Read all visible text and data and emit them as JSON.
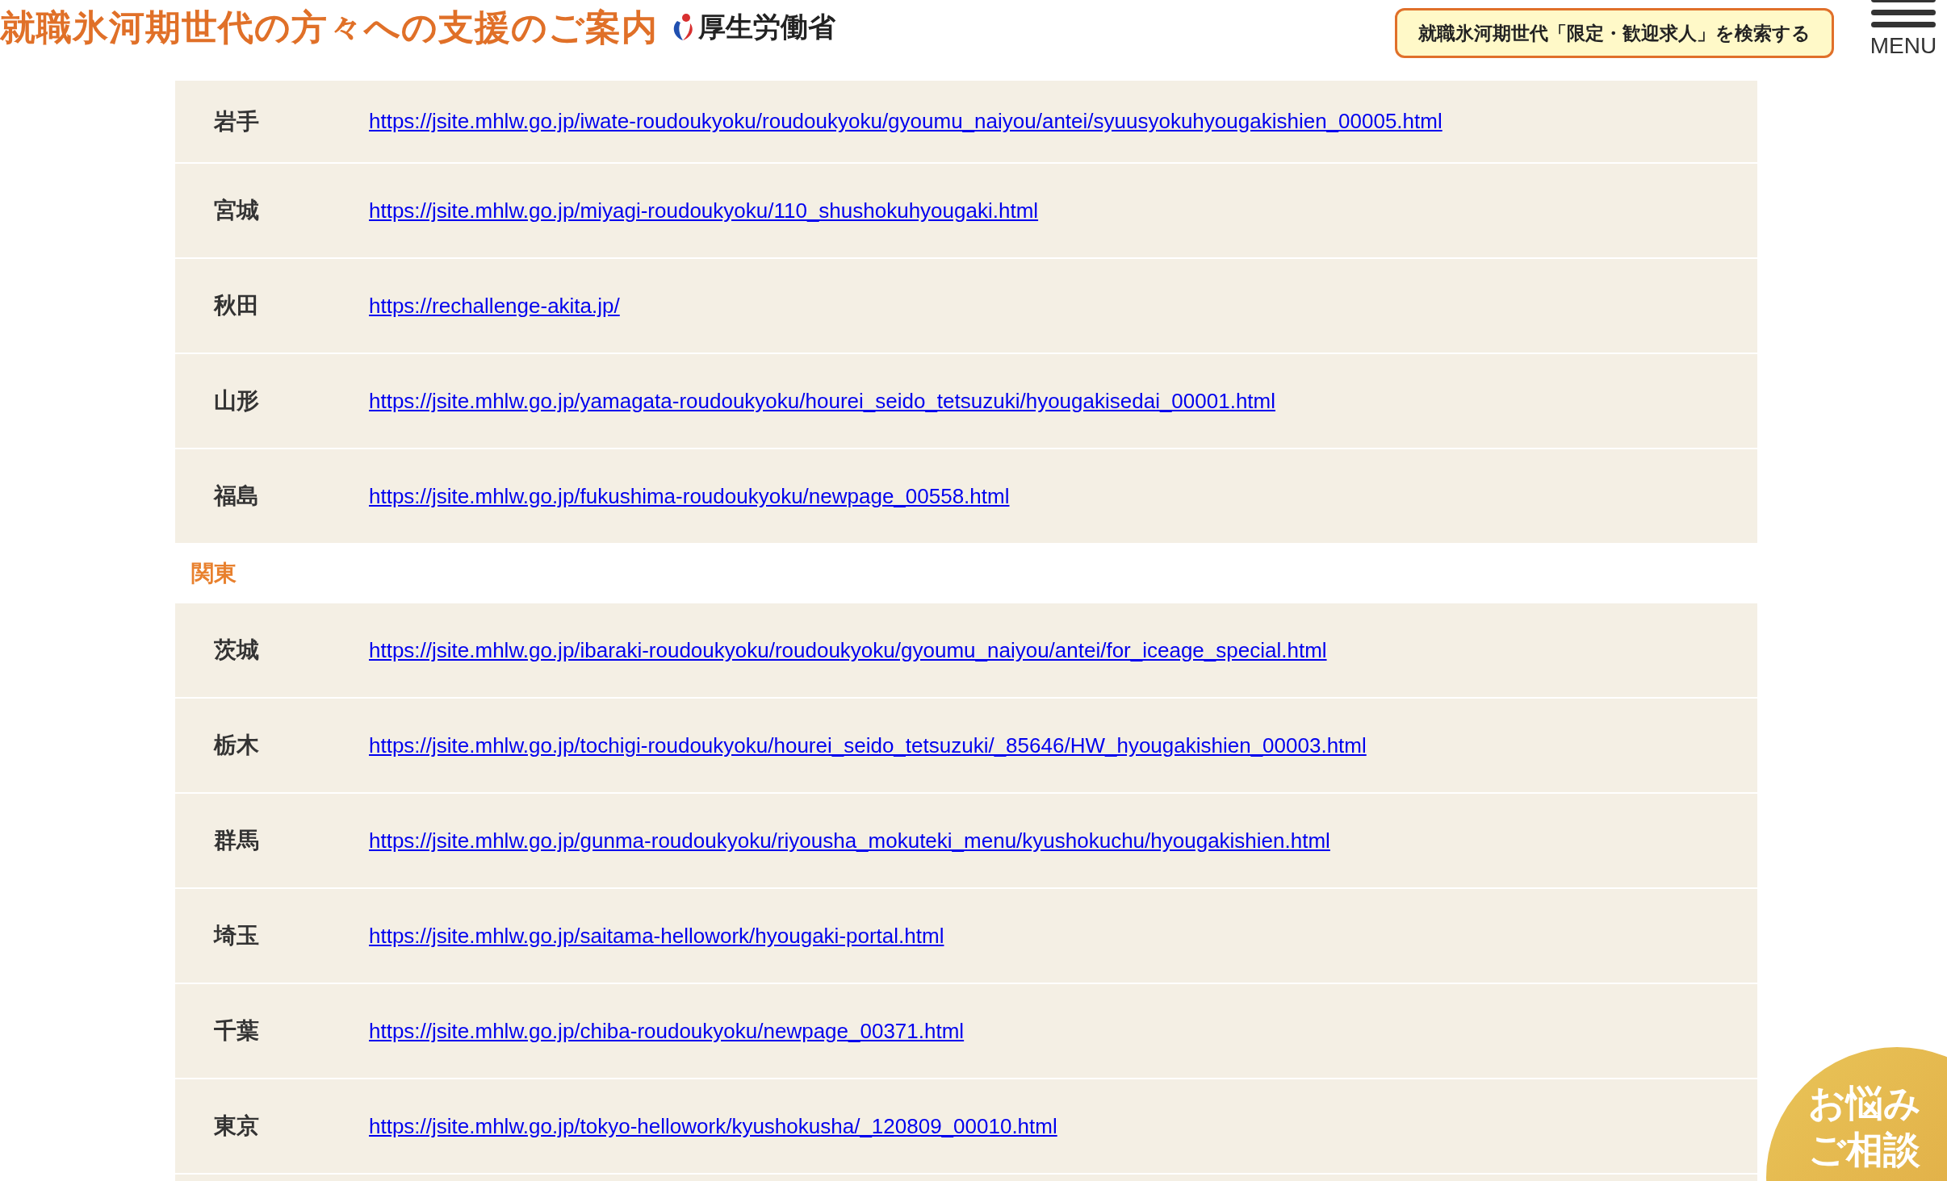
{
  "header": {
    "title": "就職氷河期世代の方々への支援のご案内",
    "logo_text": "厚生労働省",
    "search_button": "就職氷河期世代「限定・歓迎求人」を検索する",
    "menu_label": "MENU"
  },
  "groups": [
    {
      "rows": [
        {
          "prefecture": "岩手",
          "url": "https://jsite.mhlw.go.jp/iwate-roudoukyoku/roudoukyoku/gyoumu_naiyou/antei/syuusyokuhyougakishien_00005.html"
        },
        {
          "prefecture": "宮城",
          "url": "https://jsite.mhlw.go.jp/miyagi-roudoukyoku/110_shushokuhyougaki.html"
        },
        {
          "prefecture": "秋田",
          "url": "https://rechallenge-akita.jp/"
        },
        {
          "prefecture": "山形",
          "url": "https://jsite.mhlw.go.jp/yamagata-roudoukyoku/hourei_seido_tetsuzuki/hyougakisedai_00001.html"
        },
        {
          "prefecture": "福島",
          "url": "https://jsite.mhlw.go.jp/fukushima-roudoukyoku/newpage_00558.html"
        }
      ]
    },
    {
      "heading": "関東",
      "rows": [
        {
          "prefecture": "茨城",
          "url": "https://jsite.mhlw.go.jp/ibaraki-roudoukyoku/roudoukyoku/gyoumu_naiyou/antei/for_iceage_special.html"
        },
        {
          "prefecture": "栃木",
          "url": "https://jsite.mhlw.go.jp/tochigi-roudoukyoku/hourei_seido_tetsuzuki/_85646/HW_hyougakishien_00003.html"
        },
        {
          "prefecture": "群馬",
          "url": "https://jsite.mhlw.go.jp/gunma-roudoukyoku/riyousha_mokuteki_menu/kyushokuchu/hyougakishien.html"
        },
        {
          "prefecture": "埼玉",
          "url": "https://jsite.mhlw.go.jp/saitama-hellowork/hyougaki-portal.html"
        },
        {
          "prefecture": "千葉",
          "url": "https://jsite.mhlw.go.jp/chiba-roudoukyoku/newpage_00371.html"
        },
        {
          "prefecture": "東京",
          "url": "https://jsite.mhlw.go.jp/tokyo-hellowork/kyushokusha/_120809_00010.html"
        }
      ]
    }
  ],
  "floating_button": {
    "lines": [
      "お悩み",
      "ご相談"
    ]
  }
}
